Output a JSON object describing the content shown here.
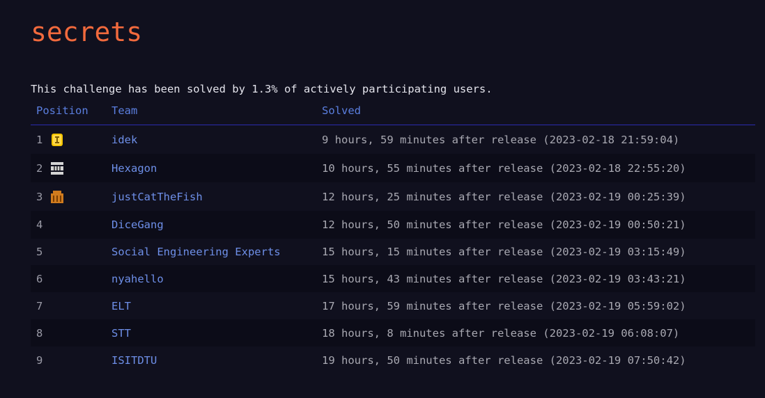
{
  "page": {
    "title": "secrets",
    "summary": "This challenge has been solved by 1.3% of actively participating users."
  },
  "table": {
    "headers": {
      "position": "Position",
      "team": "Team",
      "solved": "Solved"
    },
    "rows": [
      {
        "position": "1",
        "team": "idek",
        "solved": "9 hours, 59 minutes after release (2023-02-18 21:59:04)",
        "medal": "gold-medal-icon"
      },
      {
        "position": "2",
        "team": "Hexagon",
        "solved": "10 hours, 55 minutes after release (2023-02-18 22:55:20)",
        "medal": "silver-medal-icon"
      },
      {
        "position": "3",
        "team": "justCatTheFish",
        "solved": "12 hours, 25 minutes after release (2023-02-19 00:25:39)",
        "medal": "bronze-medal-icon"
      },
      {
        "position": "4",
        "team": "DiceGang",
        "solved": "12 hours, 50 minutes after release (2023-02-19 00:50:21)"
      },
      {
        "position": "5",
        "team": "Social Engineering Experts",
        "solved": "15 hours, 15 minutes after release (2023-02-19 03:15:49)"
      },
      {
        "position": "6",
        "team": "nyahello",
        "solved": "15 hours, 43 minutes after release (2023-02-19 03:43:21)"
      },
      {
        "position": "7",
        "team": "ELT",
        "solved": "17 hours, 59 minutes after release (2023-02-19 05:59:02)"
      },
      {
        "position": "8",
        "team": "STT",
        "solved": "18 hours, 8 minutes after release (2023-02-19 06:08:07)"
      },
      {
        "position": "9",
        "team": "ISITDTU",
        "solved": "19 hours, 50 minutes after release (2023-02-19 07:50:42)"
      }
    ]
  },
  "colors": {
    "title": "#f26a3d",
    "header": "#5b7fe0",
    "team_link": "#6e8fe8",
    "background": "#10101e",
    "gold": "#f5c400",
    "silver": "#d4d4d4",
    "bronze": "#d07b1e"
  }
}
